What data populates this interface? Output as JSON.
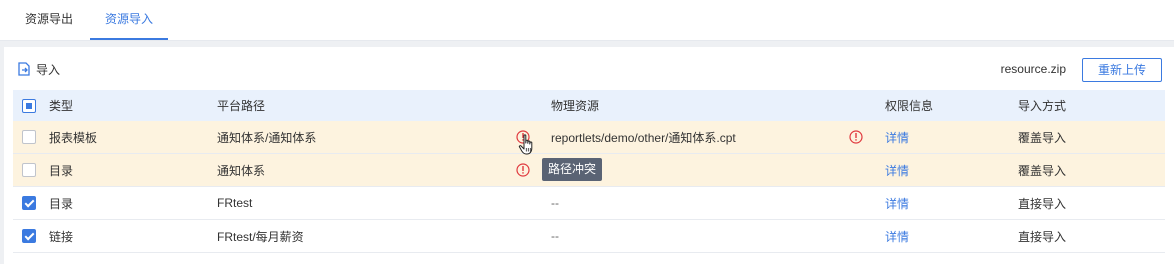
{
  "tabs": [
    {
      "label": "资源导出",
      "active": false
    },
    {
      "label": "资源导入",
      "active": true
    }
  ],
  "toolbar": {
    "import_label": "导入",
    "filename": "resource.zip",
    "reupload_label": "重新上传"
  },
  "table": {
    "headers": {
      "type": "类型",
      "path": "平台路径",
      "physical": "物理资源",
      "permission": "权限信息",
      "mode": "导入方式"
    },
    "header_checkbox": "partial",
    "rows": [
      {
        "checked": false,
        "type": "报表模板",
        "path": "通知体系/通知体系",
        "path_warning": true,
        "physical": "reportlets/demo/other/通知体系.cpt",
        "physical_warning": true,
        "permission": "详情",
        "mode": "覆盖导入",
        "conflict": true
      },
      {
        "checked": false,
        "type": "目录",
        "path": "通知体系",
        "path_warning": true,
        "physical": "",
        "physical_warning": false,
        "permission": "详情",
        "mode": "覆盖导入",
        "conflict": true
      },
      {
        "checked": true,
        "type": "目录",
        "path": "FRtest",
        "path_warning": false,
        "physical": "--",
        "physical_warning": false,
        "permission": "详情",
        "mode": "直接导入",
        "conflict": false
      },
      {
        "checked": true,
        "type": "链接",
        "path": "FRtest/每月薪资",
        "path_warning": false,
        "physical": "--",
        "physical_warning": false,
        "permission": "详情",
        "mode": "直接导入",
        "conflict": false
      }
    ]
  },
  "tooltip": {
    "text": "路径冲突"
  },
  "colors": {
    "accent": "#3b7ae0",
    "warning": "#e0393e",
    "conflict_row": "#fdf3df",
    "header_bg": "#e9f1fc"
  }
}
